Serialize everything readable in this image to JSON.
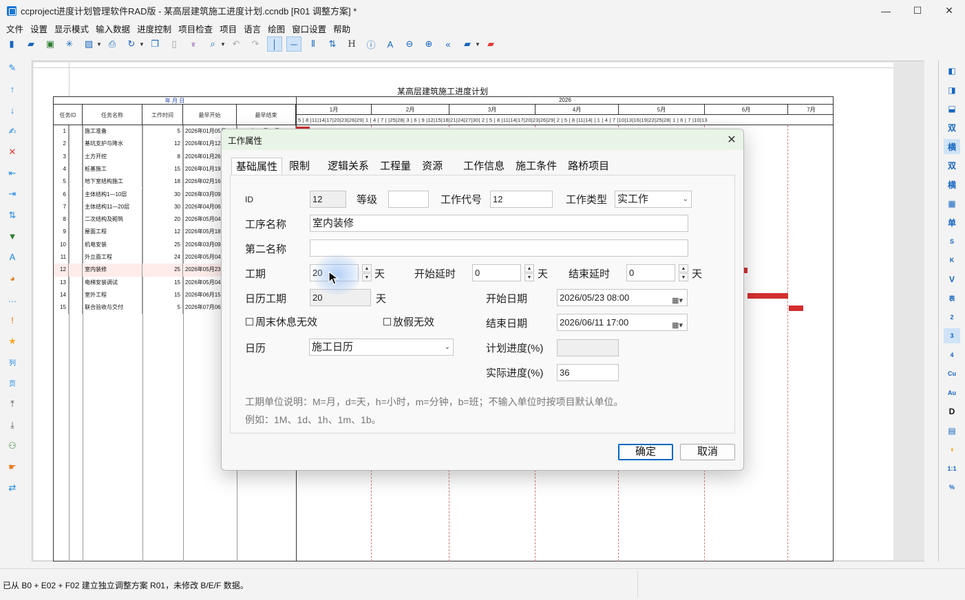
{
  "window": {
    "title": "ccproject进度计划管理软件RAD版 - 某高层建筑施工进度计划.ccndb [R01 调整方案] *",
    "minimize_glyph": "—",
    "maximize_glyph": "☐",
    "close_glyph": "✕"
  },
  "menu": [
    "文件",
    "设置",
    "显示模式",
    "输入数据",
    "进度控制",
    "项目检查",
    "项目",
    "语言",
    "绘图",
    "窗口设置",
    "帮助"
  ],
  "toolbar": {
    "icons": [
      "new-file-icon",
      "open-folder-icon",
      "save-icon",
      "asterisk-icon",
      "export-image-icon",
      "print-icon",
      "refresh-icon",
      "copy-icon",
      "paste-icon",
      "format-painter-icon",
      "find-icon",
      "undo-icon",
      "redo-icon",
      "vertical-line-icon",
      "horizontal-line-icon",
      "columns-icon",
      "sort-icon",
      "h-icon",
      "info-icon",
      "text-a-icon",
      "zoom-out-icon",
      "zoom-in-icon",
      "back-icon",
      "open-project-icon",
      "red-folder-icon"
    ]
  },
  "right_toolbar": [
    "双",
    "横",
    "双",
    "横",
    "单",
    "S",
    "K",
    "V",
    "表",
    "2",
    "3",
    "4",
    "Cu",
    "Au",
    "D",
    "1:1",
    "%"
  ],
  "gantt": {
    "title": "某高层建筑施工进度计划",
    "date_header": "年 月 日",
    "year": "2026",
    "columns": [
      "任务ID",
      "任务名称",
      "工作时间",
      "最早开始",
      "最早结束"
    ],
    "months": [
      "1月",
      "2月",
      "3月",
      "4月",
      "5月",
      "6月",
      "7月"
    ],
    "days_row": "5 | 8 |11|14|17|20|23|26|29| 1 | 4 | 7 |      |25|28| 3 | 6 | 9 |12|15|18|21|24|27|30| 2 | 5 | 8 |11|14|17|20|23|26|29| 2 | 5 | 8 |11|14|        | 1 | 4 | 7 |10|13|16|19|22|25|28| 1 | 6 | 7 |10|13",
    "tasks": [
      {
        "id": "1",
        "name": "施工准备",
        "dur": "5",
        "start": "2026年01月05日",
        "end": "2026年01月09日"
      },
      {
        "id": "2",
        "name": "基坑支护与降水",
        "dur": "12",
        "start": "2026年01月12日",
        "end": ""
      },
      {
        "id": "3",
        "name": "土方开挖",
        "dur": "8",
        "start": "2026年01月26日",
        "end": ""
      },
      {
        "id": "4",
        "name": "桩基施工",
        "dur": "15",
        "start": "2026年01月19日",
        "end": ""
      },
      {
        "id": "5",
        "name": "地下室结构施工",
        "dur": "18",
        "start": "2026年02月16日",
        "end": ""
      },
      {
        "id": "6",
        "name": "主体结构1—10层",
        "dur": "30",
        "start": "2026年03月09日",
        "end": ""
      },
      {
        "id": "7",
        "name": "主体结构11—20层",
        "dur": "30",
        "start": "2026年04月06日",
        "end": ""
      },
      {
        "id": "8",
        "name": "二次结构及砌筑",
        "dur": "20",
        "start": "2026年05月04日",
        "end": ""
      },
      {
        "id": "9",
        "name": "屋面工程",
        "dur": "12",
        "start": "2026年05月18日",
        "end": ""
      },
      {
        "id": "10",
        "name": "机电安装",
        "dur": "25",
        "start": "2026年03月09日",
        "end": ""
      },
      {
        "id": "11",
        "name": "外立面工程",
        "dur": "24",
        "start": "2026年05月04日",
        "end": ""
      },
      {
        "id": "12",
        "name": "室内装修",
        "dur": "25",
        "start": "2026年05月23日",
        "end": ""
      },
      {
        "id": "13",
        "name": "电梯安装调试",
        "dur": "15",
        "start": "2026年05月04日",
        "end": ""
      },
      {
        "id": "14",
        "name": "室外工程",
        "dur": "15",
        "start": "2026年06月15日",
        "end": ""
      },
      {
        "id": "15",
        "name": "联合验收与交付",
        "dur": "5",
        "start": "2026年07月06日",
        "end": ""
      }
    ]
  },
  "dialog": {
    "title": "工作属性",
    "close_glyph": "✕",
    "tabs": [
      "基础属性",
      "限制",
      "逻辑关系",
      "工程量",
      "资源",
      "工作信息",
      "施工条件",
      "路桥项目"
    ],
    "labels": {
      "id": "ID",
      "level": "等级",
      "work_code": "工作代号",
      "work_type": "工作类型",
      "process_name": "工序名称",
      "second_name": "第二名称",
      "duration": "工期",
      "day_unit": "天",
      "start_delay": "开始延时",
      "end_delay": "结束延时",
      "calendar_duration": "日历工期",
      "weekend_invalid": "周末休息无效",
      "holiday_invalid": "放假无效",
      "start_date": "开始日期",
      "end_date": "结束日期",
      "calendar": "日历",
      "plan_progress": "计划进度(%)",
      "actual_progress": "实际进度(%)"
    },
    "values": {
      "id": "12",
      "level": "",
      "work_code": "12",
      "work_type": "实工作",
      "process_name": "室内装修",
      "second_name": "",
      "duration": "20",
      "start_delay": "0",
      "end_delay": "0",
      "calendar_duration": "20",
      "start_date": "2026/05/23 08:00",
      "end_date": "2026/06/11 17:00",
      "calendar": "施工日历",
      "plan_progress": "",
      "actual_progress": "36"
    },
    "note_line1": "工期单位说明：M=月，d=天，h=小时，m=分钟，b=班；不输入单位时按项目默认单位。",
    "note_line2": "例如：1M、1d、1h、1m、1b。",
    "ok_label": "确定",
    "cancel_label": "取消"
  },
  "status": {
    "message": "已从 B0 + E02 + F02 建立独立调整方案 R01，未修改 B/E/F 数据。"
  },
  "colors": {
    "bar": "#d32f2f",
    "dialog_title_bg": "#e8f4e5",
    "accent": "#0067c0",
    "icon_blue": "#1565c0"
  }
}
